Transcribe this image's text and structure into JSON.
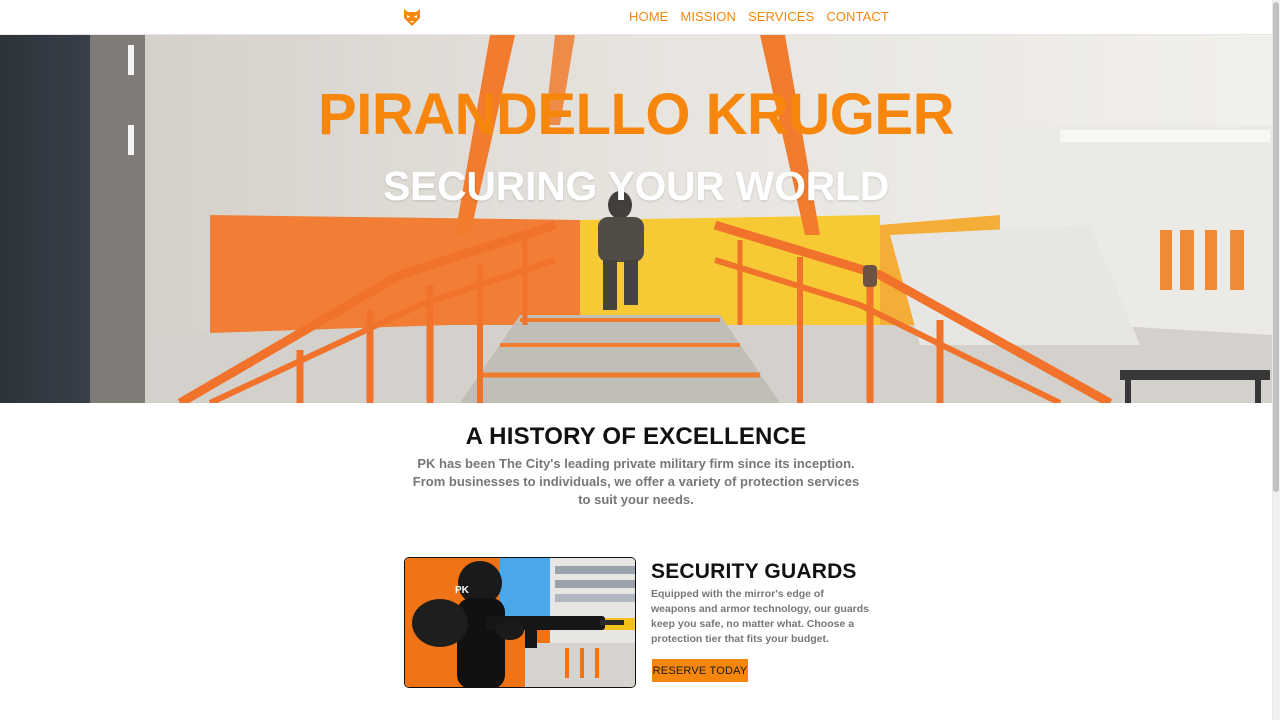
{
  "nav": {
    "logo_icon": "fox-mask-logo-icon",
    "links": [
      "HOME",
      "MISSION",
      "SERVICES",
      "CONTACT"
    ]
  },
  "hero": {
    "title": "PIRANDELLO KRUGER",
    "subtitle": "SECURING YOUR WORLD"
  },
  "history": {
    "heading": "A HISTORY OF EXCELLENCE",
    "text": "PK has been The City's leading private military firm since its inception. From businesses to individuals, we offer a variety of protection services to suit your needs."
  },
  "service": {
    "title": "SECURITY GUARDS",
    "text": "Equipped with the mirror's edge of weapons and armor technology, our guards keep you safe, no matter what. Choose a protection tier that fits your budget.",
    "button": "RESERVE TODAY",
    "image_badge": "PK"
  },
  "colors": {
    "accent": "#f7860c",
    "heading": "#111111",
    "body_text": "#777777"
  }
}
